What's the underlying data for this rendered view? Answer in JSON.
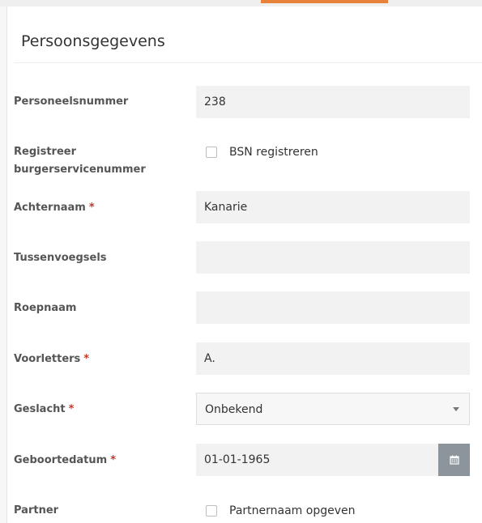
{
  "section_title": "Persoonsgegevens",
  "required_marker": "*",
  "fields": {
    "personeelsnummer": {
      "label": "Personeelsnummer",
      "value": "238"
    },
    "bsn": {
      "label": "Registreer burgerservicenummer",
      "checkbox_label": "BSN registreren",
      "checked": false
    },
    "achternaam": {
      "label": "Achternaam",
      "value": "Kanarie"
    },
    "tussenvoegsels": {
      "label": "Tussenvoegsels",
      "value": ""
    },
    "roepnaam": {
      "label": "Roepnaam",
      "value": ""
    },
    "voorletters": {
      "label": "Voorletters",
      "value": "A."
    },
    "geslacht": {
      "label": "Geslacht",
      "value": "Onbekend"
    },
    "geboortedatum": {
      "label": "Geboortedatum",
      "value": "01-01-1965",
      "icon": "calendar-icon"
    },
    "partner": {
      "label": "Partner",
      "checkbox_label": "Partnernaam opgeven",
      "checked": false
    }
  },
  "colors": {
    "accent": "#e8813a",
    "required": "#c0392b",
    "calendar_button": "#8c949c"
  }
}
